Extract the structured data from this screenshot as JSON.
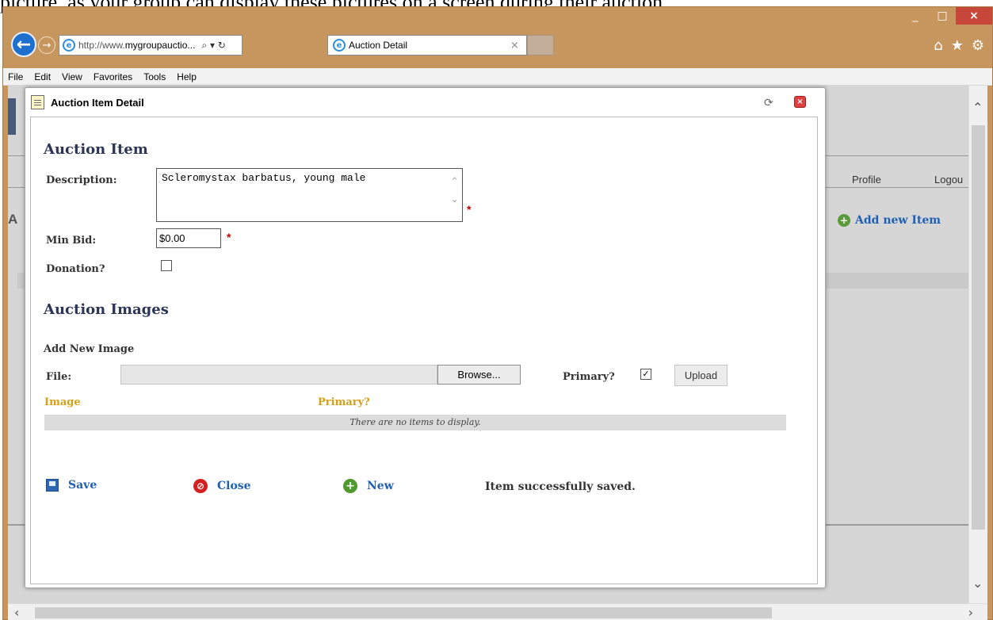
{
  "document": {
    "caption": "picture, as your group can display these pictures on a screen during their auction."
  },
  "browser": {
    "url_prefix": "http://www.",
    "url_domain": "mygroupauctio...",
    "address_icons": "⌕ ▾ ↻",
    "tab_title": "Auction Detail",
    "tab_close": "×",
    "menu": [
      "File",
      "Edit",
      "View",
      "Favorites",
      "Tools",
      "Help"
    ],
    "window_buttons": {
      "minimize": "_",
      "maximize": "□",
      "close": "×"
    },
    "right_icons": {
      "home": "⌂",
      "favorites": "★",
      "settings": "⚙"
    }
  },
  "background_page": {
    "profile": "Profile",
    "logout": "Logou",
    "heading_letter": "A",
    "add_item": "Add new Item"
  },
  "dialog": {
    "title": "Auction Item Detail",
    "section_item": "Auction Item",
    "description_label": "Description:",
    "description_value": "Scleromystax barbatus, young male",
    "min_bid_label": "Min Bid:",
    "min_bid_value": "$0.00",
    "donation_label": "Donation?",
    "donation_checked": false,
    "required_marker": "*",
    "section_images": "Auction Images",
    "add_new_image": "Add New Image",
    "file_label": "File:",
    "browse_label": "Browse...",
    "primary_label": "Primary?",
    "primary_checked": true,
    "upload_label": "Upload",
    "grid_col_image": "Image",
    "grid_col_primary": "Primary?",
    "grid_empty": "There are no items to display.",
    "save_label": "Save",
    "close_label": "Close",
    "new_label": "New",
    "status_message": "Item successfully saved."
  }
}
